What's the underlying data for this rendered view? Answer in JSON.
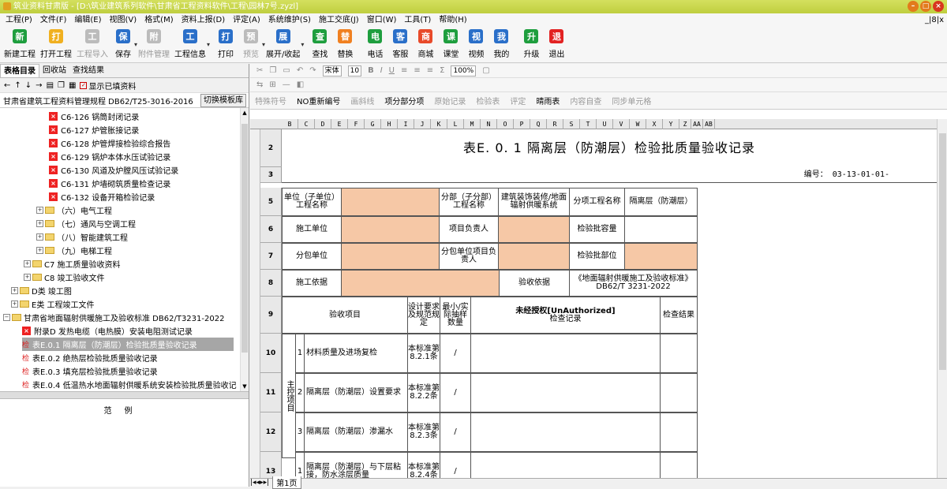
{
  "window": {
    "title": "筑业资料甘肃版 - [D:\\筑业建筑系列软件\\甘肃省工程资料软件\\工程\\园林7号.zyzl]"
  },
  "menu": [
    "工程(P)",
    "文件(F)",
    "编辑(E)",
    "视图(V)",
    "格式(M)",
    "资料上报(D)",
    "评定(A)",
    "系统维护(S)",
    "施工交底(J)",
    "窗口(W)",
    "工具(T)",
    "帮助(H)"
  ],
  "menu_right": "_|8|x",
  "toolbar": [
    {
      "label": "新建工程",
      "icon": "plus-icon",
      "color": "#1e9e3e"
    },
    {
      "label": "打开工程",
      "icon": "folder-icon",
      "color": "#f0b020"
    },
    {
      "label": "工程导入",
      "icon": "import-icon",
      "color": "#bbbbbb",
      "disabled": true
    },
    {
      "label": "保存",
      "icon": "save-icon",
      "color": "#2a6fc9"
    },
    {
      "label": "附件管理",
      "icon": "attachment-icon",
      "color": "#bbbbbb",
      "disabled": true
    },
    {
      "label": "工程信息",
      "icon": "info-icon",
      "color": "#2a6fc9"
    },
    {
      "label": "打印",
      "icon": "print-icon",
      "color": "#2a6fc9"
    },
    {
      "label": "预览",
      "icon": "preview-icon",
      "color": "#bbbbbb",
      "disabled": true
    },
    {
      "label": "展开/收起",
      "icon": "expand-icon",
      "color": "#2a6fc9"
    },
    {
      "label": "查找",
      "icon": "find-icon",
      "color": "#1e9e3e"
    },
    {
      "label": "替换",
      "icon": "replace-icon",
      "color": "#f08020"
    },
    {
      "label": "电话",
      "icon": "phone-icon",
      "color": "#1e9e3e"
    },
    {
      "label": "客服",
      "icon": "service-icon",
      "color": "#2a6fc9"
    },
    {
      "label": "商城",
      "icon": "shop-icon",
      "color": "#e84a2a"
    },
    {
      "label": "课堂",
      "icon": "class-icon",
      "color": "#1e9e3e"
    },
    {
      "label": "视频",
      "icon": "video-icon",
      "color": "#2a6fc9"
    },
    {
      "label": "我的",
      "icon": "user-icon",
      "color": "#2a6fc9"
    },
    {
      "label": "升级",
      "icon": "upgrade-icon",
      "color": "#1e9e3e"
    },
    {
      "label": "退出",
      "icon": "power-icon",
      "color": "#e22222"
    }
  ],
  "left": {
    "tabs": [
      "表格目录",
      "回收站",
      "查找结果"
    ],
    "checkbox_label": "显示已填资料",
    "standard": "甘肃省建筑工程资料管理规程 DB62/T25-3016-2016",
    "switch_button": "切换模板库",
    "tree": [
      {
        "label": "C6-126 锅筒封闭记录",
        "kind": "red"
      },
      {
        "label": "C6-127 炉管胀接记录",
        "kind": "red"
      },
      {
        "label": "C6-128 炉管焊接检验综合报告",
        "kind": "red"
      },
      {
        "label": "C6-129 锅炉本体水压试验记录",
        "kind": "red"
      },
      {
        "label": "C6-130 风道及炉膛风压试验记录",
        "kind": "red"
      },
      {
        "label": "C6-131 炉墙砌筑质量检查记录",
        "kind": "red"
      },
      {
        "label": "C6-132 设备开箱检验记录",
        "kind": "red"
      },
      {
        "label": "（六）电气工程",
        "kind": "folder"
      },
      {
        "label": "（七）通风与空调工程",
        "kind": "folder"
      },
      {
        "label": "（八）智能建筑工程",
        "kind": "folder"
      },
      {
        "label": "（九）电梯工程",
        "kind": "folder"
      },
      {
        "label": "C7 施工质量验收资料",
        "kind": "folder"
      },
      {
        "label": "C8 竣工验收文件",
        "kind": "folder"
      },
      {
        "label": "D类 竣工图",
        "kind": "folder"
      },
      {
        "label": "E类 工程竣工文件",
        "kind": "folder"
      },
      {
        "label": "甘肃省地面辐射供暖施工及验收标准 DB62/T3231-2022",
        "kind": "folder-open"
      },
      {
        "label": "附录D 发热电缆（电热膜）安装电阻测试记录",
        "kind": "red"
      },
      {
        "label": "表E.0.1 隔离层（防潮层）检验批质量验收记录",
        "kind": "jian",
        "selected": true
      },
      {
        "label": "表E.0.2 绝热层检验批质量验收记录",
        "kind": "jian"
      },
      {
        "label": "表E.0.3 填充层检验批质量验收记录",
        "kind": "jian"
      },
      {
        "label": "表E.0.4 低温热水地面辐射供暖系统安装检验批质量验收记",
        "kind": "jian"
      }
    ],
    "example_title": "范例"
  },
  "format_bar": {
    "font": "宋体",
    "size": "10",
    "zoom": "100%"
  },
  "toolrow": [
    {
      "label": "特殊符号",
      "disabled": true
    },
    {
      "label": "NO重新编号",
      "disabled": false
    },
    {
      "label": "画斜线",
      "disabled": true
    },
    {
      "label": "项分部分项",
      "disabled": false
    },
    {
      "label": "原始记录",
      "disabled": true
    },
    {
      "label": "检验表",
      "disabled": true
    },
    {
      "label": "评定",
      "disabled": true
    },
    {
      "label": "晴雨表",
      "disabled": false
    },
    {
      "label": "内容自查",
      "disabled": true
    },
    {
      "label": "同步单元格",
      "disabled": true
    }
  ],
  "columns": [
    "B",
    "C",
    "D",
    "E",
    "F",
    "G",
    "H",
    "I",
    "J",
    "K",
    "L",
    "M",
    "N",
    "O",
    "P",
    "Q",
    "R",
    "S",
    "T",
    "U",
    "V",
    "W",
    "X",
    "Y",
    "Z",
    "AA",
    "AB"
  ],
  "rows": [
    "2",
    "3",
    "5",
    "6",
    "7",
    "8",
    "9",
    "10",
    "11",
    "12",
    "13"
  ],
  "form": {
    "title": "表E. 0. 1 隔离层（防潮层）检验批质量验收记录",
    "code_label": "编号：",
    "code_value": "03-13-01-01-",
    "unit_name_label": "单位（子单位）工程名称",
    "subdiv_label": "分部（子分部）工程名称",
    "subdiv_value": "建筑装饰装修/地面辐射供暖系统",
    "subitem_label": "分项工程名称",
    "subitem_value": "隔离层（防潮层）",
    "construct_unit": "施工单位",
    "project_lead": "项目负责人",
    "batch_capacity": "检验批容量",
    "sub_unit": "分包单位",
    "sub_lead": "分包单位项目负责人",
    "batch_part": "检验批部位",
    "basis_label": "施工依据",
    "accept_basis": "验收依据",
    "accept_value": "《地面辐射供暖施工及验收标准》DB62/T 3231-2022",
    "item_header": "验收项目",
    "design_req": "设计要求及规范规定",
    "sample_count": "最小/实际抽样数量",
    "check_record": "检查记录",
    "check_result": "检查结果",
    "watermark": "未经授权[UnAuthorized]",
    "main_label": "主控项目",
    "items": [
      {
        "no": "1",
        "name": "材料质量及进场复检",
        "req": "本标准第8.2.1条",
        "sample": "/"
      },
      {
        "no": "2",
        "name": "隔离层（防潮层）设置要求",
        "req": "本标准第8.2.2条",
        "sample": "/"
      },
      {
        "no": "3",
        "name": "隔离层（防潮层）渗漏水",
        "req": "本标准第8.2.3条",
        "sample": "/"
      },
      {
        "no": "1",
        "name": "隔离层（防潮层）与下层粘接，防水涂层质量",
        "req": "本标准第8.2.4条",
        "sample": "/"
      }
    ]
  },
  "sheet_tab": "第1页"
}
